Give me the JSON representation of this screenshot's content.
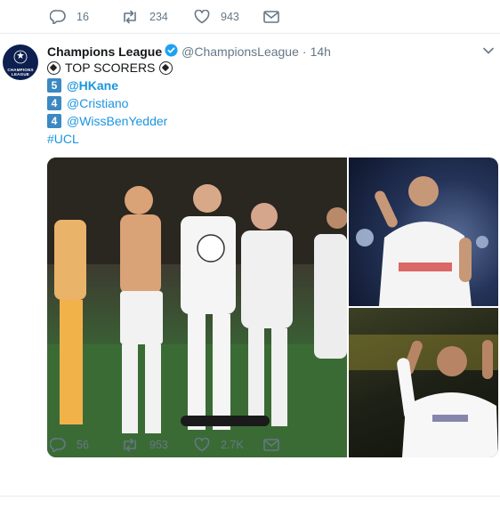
{
  "previous_tweet": {
    "actions": {
      "reply_count": "16",
      "retweet_count": "234",
      "like_count": "943"
    }
  },
  "tweet": {
    "author": {
      "name": "Champions League",
      "handle": "@ChampionsLeague",
      "time": "14h",
      "avatar_text_line1": "CHAMPIONS",
      "avatar_text_line2": "LEAGUE",
      "verified_icon": "verified-badge-icon"
    },
    "lines": {
      "title": "TOP SCORERS",
      "scorers": [
        {
          "rank": "5",
          "mention": "@HKane"
        },
        {
          "rank": "4",
          "mention": "@Cristiano"
        },
        {
          "rank": "4",
          "mention": "@WissBenYedder"
        }
      ],
      "hashtag": "#UCL"
    },
    "media": {
      "photos": [
        "team-celebration-photo",
        "ben-yedder-celebration-photo",
        "ronaldo-celebration-photo"
      ]
    },
    "actions": {
      "reply_count": "56",
      "retweet_count": "953",
      "like_count": "2.7K"
    }
  },
  "colors": {
    "link": "#1b95e0",
    "muted": "#657786",
    "verified": "#1da1f2",
    "keycap": "#3b88c3"
  }
}
